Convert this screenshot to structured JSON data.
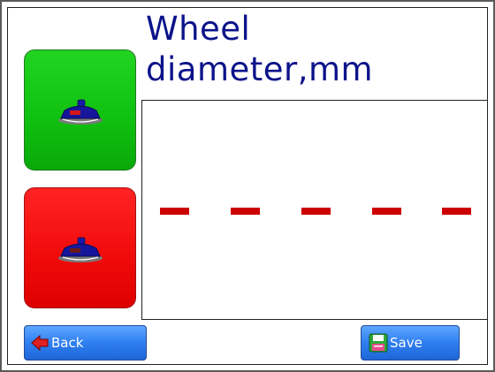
{
  "screen": {
    "title_line1": "Wheel",
    "title_line2": "diameter,mm"
  },
  "side_buttons": {
    "upper": {
      "color": "#12c912",
      "icon": "wheel-gauge-icon"
    },
    "lower": {
      "color": "#f30f0f",
      "icon": "wheel-gauge-icon"
    }
  },
  "display": {
    "value_placeholder": "- - - - -",
    "dash_color": "#cc0000"
  },
  "footer": {
    "back_label": "Back",
    "save_label": "Save",
    "button_color": "#2f7ff0"
  }
}
